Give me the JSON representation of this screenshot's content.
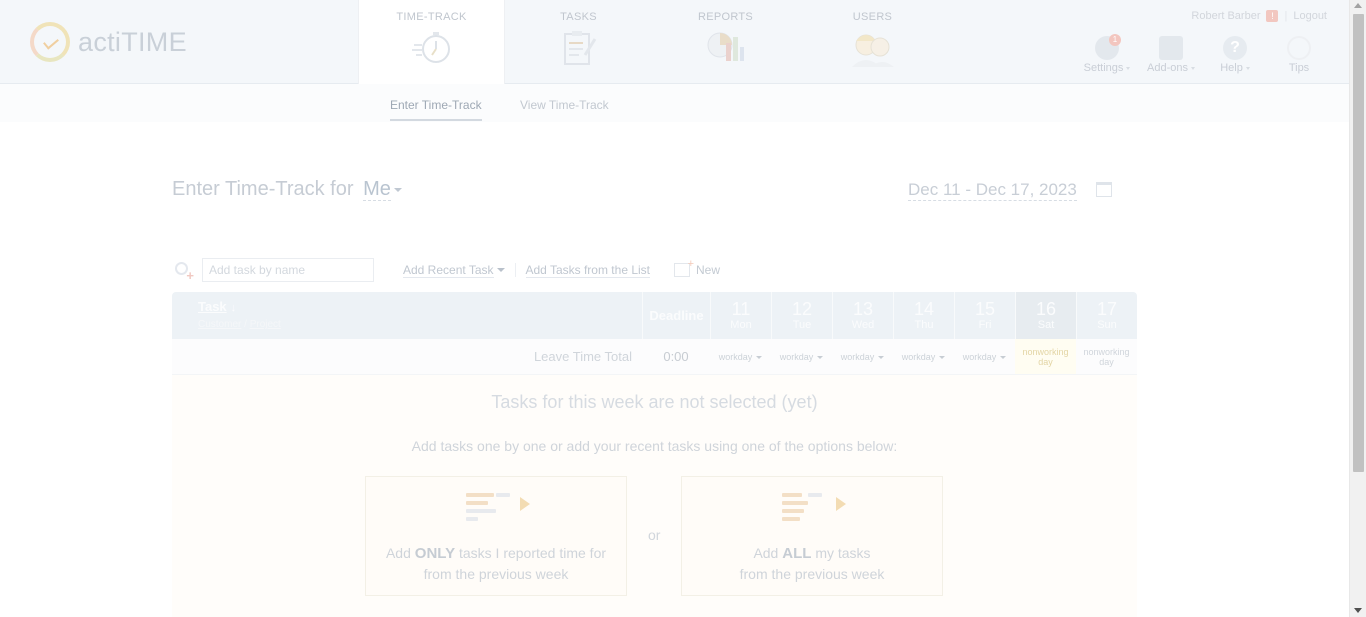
{
  "header": {
    "app_name": "actiTIME",
    "nav": [
      {
        "label": "TIME-TRACK",
        "icon": "stopwatch-icon"
      },
      {
        "label": "TASKS",
        "icon": "clipboard-icon"
      },
      {
        "label": "REPORTS",
        "icon": "report-chart-icon"
      },
      {
        "label": "USERS",
        "icon": "users-icon"
      }
    ],
    "user_name": "Robert Barber",
    "warning_glyph": "!",
    "logout_label": "Logout",
    "tools": [
      {
        "label": "Settings",
        "icon": "gear-icon",
        "badge": "1"
      },
      {
        "label": "Add-ons",
        "icon": "puzzle-icon"
      },
      {
        "label": "Help",
        "icon": "help-icon",
        "glyph": "?"
      },
      {
        "label": "Tips",
        "icon": "lightbulb-icon"
      }
    ]
  },
  "subnav": {
    "tabs": [
      {
        "label": "Enter Time-Track",
        "active": true
      },
      {
        "label": "View Time-Track",
        "active": false
      }
    ]
  },
  "page": {
    "title": "Enter Time-Track for",
    "user_select": "Me",
    "week_range": "Dec 11 - Dec 17, 2023"
  },
  "add_task": {
    "placeholder": "Add task by name",
    "recent_label": "Add Recent Task",
    "from_list_label": "Add Tasks from the List",
    "new_label": "New"
  },
  "grid": {
    "task_header": "Task",
    "sort_glyph": "↓",
    "customer_label": "Customer",
    "path_separator": "/",
    "project_label": "Project",
    "deadline_header": "Deadline",
    "days": [
      {
        "num": "11",
        "dow": "Mon",
        "status": "workday"
      },
      {
        "num": "12",
        "dow": "Tue",
        "status": "workday"
      },
      {
        "num": "13",
        "dow": "Wed",
        "status": "workday"
      },
      {
        "num": "14",
        "dow": "Thu",
        "status": "workday"
      },
      {
        "num": "15",
        "dow": "Fri",
        "status": "workday"
      },
      {
        "num": "16",
        "dow": "Sat",
        "status_line1": "nonworking",
        "status_line2": "day"
      },
      {
        "num": "17",
        "dow": "Sun",
        "status_line1": "nonworking",
        "status_line2": "day"
      }
    ],
    "leave_label": "Leave Time Total",
    "leave_total": "0:00"
  },
  "empty_state": {
    "title": "Tasks for this week are not selected (yet)",
    "subtitle": "Add tasks one by one or add your recent tasks using one of the options below:",
    "left_card": {
      "prefix": "Add",
      "emphasis": "ONLY",
      "rest": "tasks I reported time for",
      "line2": "from the previous week"
    },
    "right_card": {
      "prefix": "Add",
      "emphasis": "ALL",
      "rest": "my tasks",
      "line2": "from the previous week"
    },
    "or_label": "or"
  },
  "colors": {
    "accent": "#b9c4d0",
    "grid_header": "#edf2f6",
    "weekend_header": "#e7ecf0",
    "nonworking_bg": "#fffdf2"
  }
}
